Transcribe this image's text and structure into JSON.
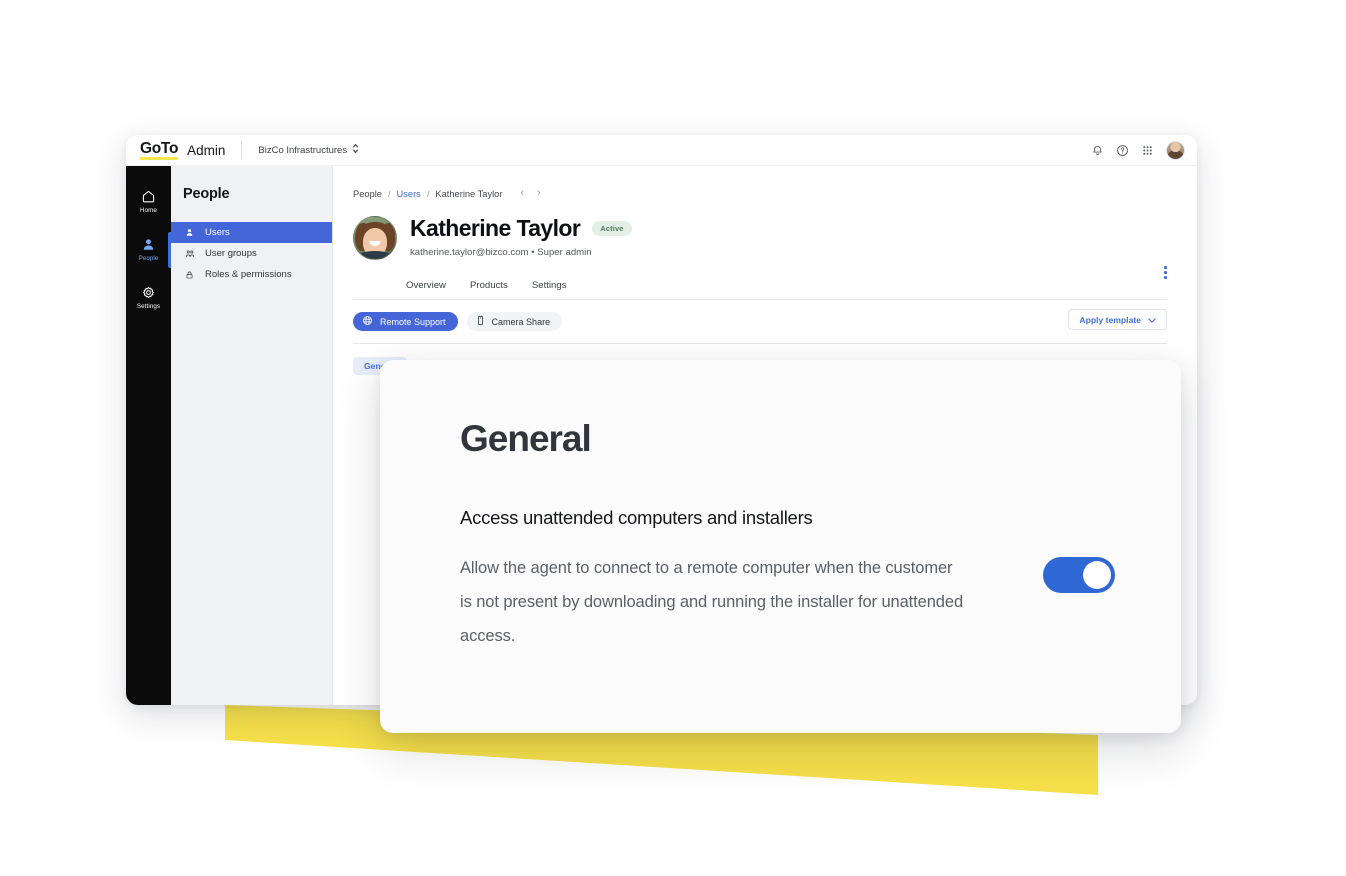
{
  "brand": {
    "logo_text": "GoTo",
    "product_label": "Admin",
    "accent_yellow": "#f6e04a",
    "accent_blue": "#4466d8",
    "toggle_blue": "#2f68d4"
  },
  "topbar": {
    "org_name": "BizCo Infrastructures",
    "org_switcher_icon": "chevron-up-down-icon",
    "notifications_icon": "bell-icon",
    "help_icon": "help-circle-icon",
    "apps_icon": "grid-apps-icon",
    "avatar_icon": "user-avatar"
  },
  "rail": {
    "items": [
      {
        "label": "Home",
        "icon": "home-icon",
        "active": false
      },
      {
        "label": "People",
        "icon": "person-icon",
        "active": true
      },
      {
        "label": "Settings",
        "icon": "gear-icon",
        "active": false
      }
    ]
  },
  "subnav": {
    "title": "People",
    "items": [
      {
        "label": "Users",
        "icon": "person-filled-icon",
        "active": true
      },
      {
        "label": "User groups",
        "icon": "people-group-icon",
        "active": false
      },
      {
        "label": "Roles & permissions",
        "icon": "lock-icon",
        "active": false
      }
    ]
  },
  "breadcrumb": {
    "root": "People",
    "separator": "/",
    "section": "Users",
    "current": "Katherine Taylor",
    "prev_icon": "chevron-left-icon",
    "next_icon": "chevron-right-icon"
  },
  "profile": {
    "name": "Katherine Taylor",
    "status_badge": "Active",
    "email": "katherine.taylor@bizco.com",
    "meta_separator": "•",
    "role": "Super admin",
    "more_menu_icon": "kebab-menu-icon"
  },
  "tabs": [
    {
      "label": "Overview",
      "active": false
    },
    {
      "label": "Products",
      "active": false
    },
    {
      "label": "Settings",
      "active": false
    }
  ],
  "products": {
    "chips": [
      {
        "label": "Remote Support",
        "icon": "remote-support-icon",
        "selected": true
      },
      {
        "label": "Camera Share",
        "icon": "mobile-device-icon",
        "selected": false
      }
    ],
    "apply_template_label": "Apply template",
    "apply_template_icon": "chevron-down-icon"
  },
  "pill_tabs": [
    {
      "label": "General",
      "active": true
    }
  ],
  "overlay": {
    "title": "General",
    "section_heading": "Access unattended computers and installers",
    "description": "Allow the agent to connect to a remote computer when the customer is not present by downloading and running the installer for unattended access.",
    "toggle_state": "on",
    "toggle_name": "unattended-access-toggle"
  }
}
